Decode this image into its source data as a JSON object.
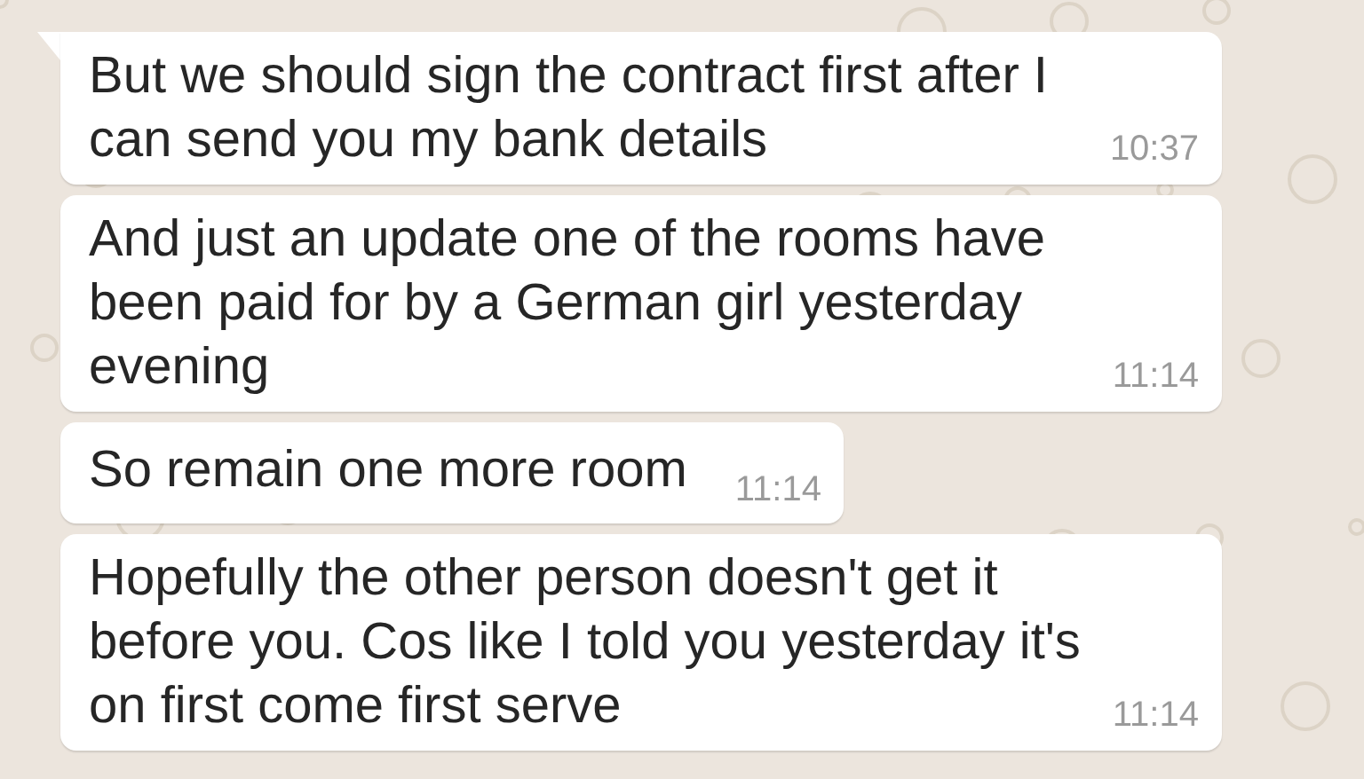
{
  "messages": [
    {
      "text": "But we should sign the contract first after I\ncan send you my bank details",
      "time": "10:37",
      "tail": true
    },
    {
      "text": "And just an update one of the rooms have\nbeen paid for by a German girl yesterday\nevening",
      "time": "11:14",
      "tail": false
    },
    {
      "text": "So remain one more room",
      "time": "11:14",
      "tail": false
    },
    {
      "text": "Hopefully the other person doesn't get it\nbefore you. Cos like I told you yesterday it's\non first come first serve",
      "time": "11:14",
      "tail": false
    }
  ]
}
